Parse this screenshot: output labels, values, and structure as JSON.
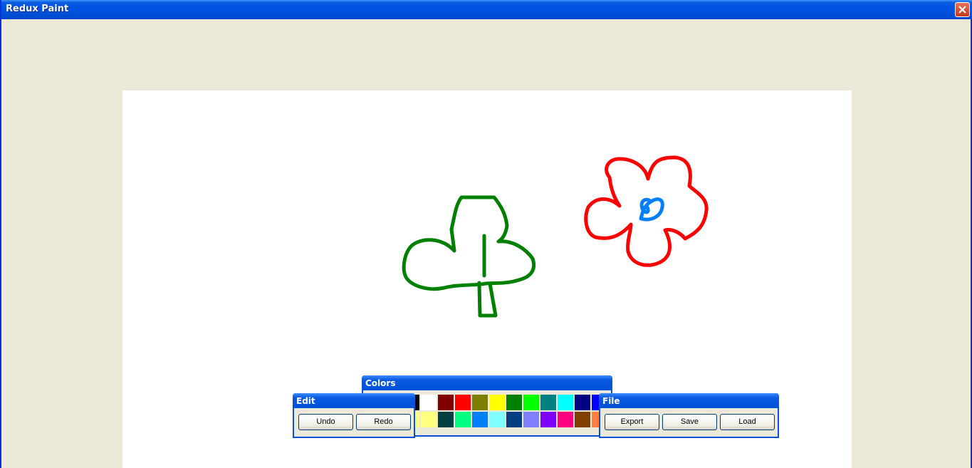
{
  "window": {
    "title": "Redux Paint"
  },
  "colors_panel": {
    "title": "Colors",
    "row1": [
      "#000000",
      "#ffffff",
      "#800000",
      "#ff0000",
      "#808000",
      "#ffff00",
      "#008000",
      "#00ff00",
      "#008080",
      "#00ffff",
      "#000080",
      "#0000ff"
    ],
    "row2": [
      "#ffff80",
      "#ffff80",
      "#004040",
      "#00ff80",
      "#0080ff",
      "#80ffff",
      "#004080",
      "#8080ff",
      "#8000ff",
      "#ff0080",
      "#804000",
      "#ff8040"
    ]
  },
  "edit_panel": {
    "title": "Edit",
    "undo_label": "Undo",
    "redo_label": "Redo"
  },
  "file_panel": {
    "title": "File",
    "export_label": "Export",
    "save_label": "Save",
    "load_label": "Load"
  },
  "drawing": {
    "clover_color": "#008000",
    "flower_color": "#ff0000",
    "center_color": "#0080ff"
  }
}
